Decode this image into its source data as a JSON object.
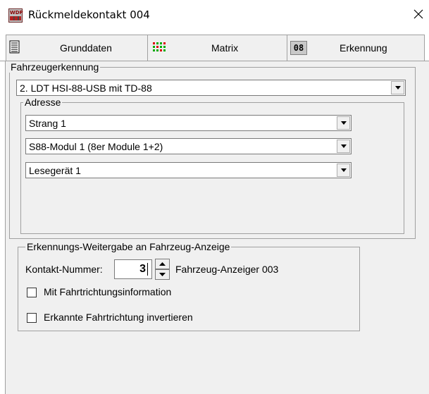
{
  "window": {
    "title": "Rückmeldekontakt 004",
    "icon_text": "WDP"
  },
  "tabs": [
    {
      "label": "Grunddaten",
      "icon": "document-icon"
    },
    {
      "label": "Matrix",
      "icon": "matrix-grid-icon"
    },
    {
      "label": "Erkennung",
      "icon": "number-badge-icon",
      "badge": "08"
    }
  ],
  "fahrzeugerkennung": {
    "legend": "Fahrzeugerkennung",
    "selected": "2. LDT HSI-88-USB mit TD-88"
  },
  "adresse": {
    "legend": "Adresse",
    "strang": "Strang 1",
    "modul": "S88-Modul 1 (8er Module 1+2)",
    "lesegeraet": "Lesegerät 1"
  },
  "weitergabe": {
    "legend": "Erkennungs-Weitergabe an Fahrzeug-Anzeige",
    "kontakt_label": "Kontakt-Nummer:",
    "kontakt_value": "3",
    "anzeiger_label": "Fahrzeug-Anzeiger 003",
    "check1_label": "Mit Fahrtrichtungsinformation",
    "check1_checked": false,
    "check2_label": "Erkannte Fahrtrichtung invertieren",
    "check2_checked": false
  }
}
